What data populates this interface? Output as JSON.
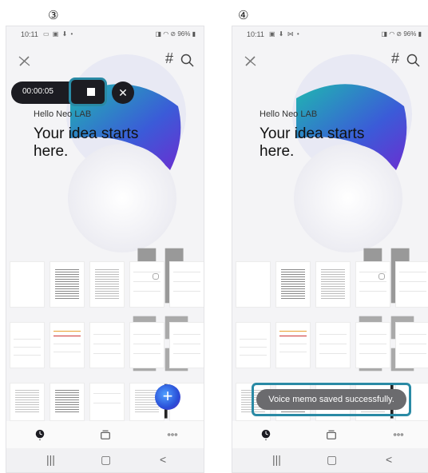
{
  "steps": {
    "left": "③",
    "right": "④"
  },
  "status": {
    "time": "10:11",
    "battery": "96%"
  },
  "hero": {
    "hello": "Hello Neo LAB",
    "idea": "Your idea starts here."
  },
  "recorder": {
    "time": "00:00:05",
    "close": "✕"
  },
  "toolbar": {
    "hash": "#"
  },
  "fab": {
    "label": "+"
  },
  "toast": {
    "message": "Voice memo saved successfully."
  },
  "nav": {
    "recent": "|||",
    "home": "▢",
    "back": "<"
  },
  "colors": {
    "accent": "#2a8aa5",
    "recorder_bg": "#1c1c22",
    "toast_bg": "#6b6b6e"
  }
}
